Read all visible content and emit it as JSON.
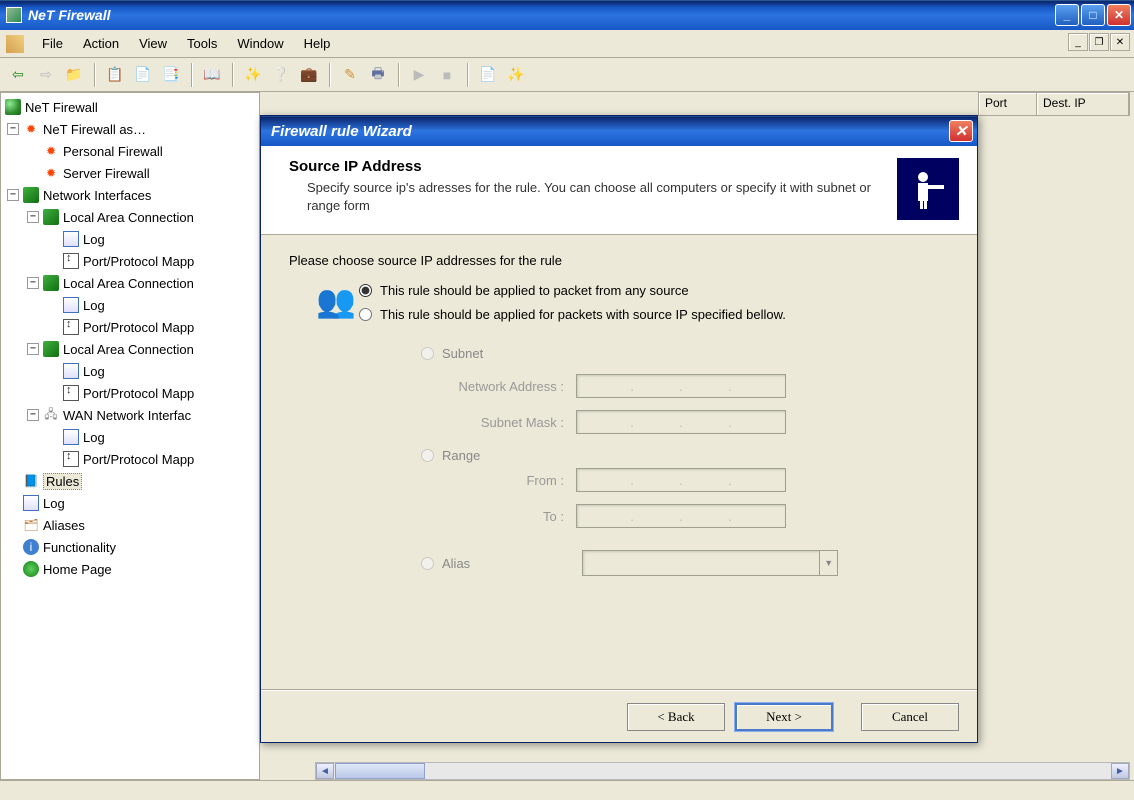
{
  "window": {
    "title": "NeT Firewall"
  },
  "menubar": {
    "items": [
      "File",
      "Action",
      "View",
      "Tools",
      "Window",
      "Help"
    ]
  },
  "tree": {
    "root": "NeT Firewall",
    "firewall_as": "NeT Firewall as…",
    "personal": "Personal Firewall",
    "server": "Server Firewall",
    "interfaces": "Network Interfaces",
    "lan": "Local Area Connection",
    "log": "Log",
    "ppm": "Port/Protocol Mapp",
    "wan": "WAN Network Interfac",
    "rules": "Rules",
    "log_root": "Log",
    "aliases": "Aliases",
    "functionality": "Functionality",
    "home": "Home Page"
  },
  "list_headers": {
    "port": "Port",
    "destip": "Dest. IP"
  },
  "dialog": {
    "title": "Firewall rule Wizard",
    "heading": "Source IP Address",
    "description": "Specify source ip's adresses for the rule. You can choose all computers or specify it with subnet or range form",
    "prompt": "Please choose source IP addresses for the rule",
    "opt_any": "This rule should be applied to packet from any source",
    "opt_specified": "This rule should be applied for packets with source IP specified bellow.",
    "sub_subnet": "Subnet",
    "lbl_netaddr": "Network Address :",
    "lbl_mask": "Subnet Mask :",
    "sub_range": "Range",
    "lbl_from": "From :",
    "lbl_to": "To :",
    "sub_alias": "Alias",
    "btn_back": "< Back",
    "btn_next": "Next >",
    "btn_cancel": "Cancel"
  }
}
